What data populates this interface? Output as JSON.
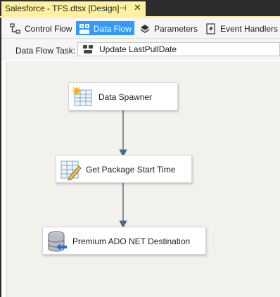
{
  "document_tab": {
    "title": "Salesforce - TFS.dtsx [Design]",
    "pin_glyph": "⊣",
    "close_glyph": "✕"
  },
  "designer_tabs": [
    {
      "label": "Control Flow",
      "icon": "control-flow-icon",
      "active": false
    },
    {
      "label": "Data Flow",
      "icon": "data-flow-icon",
      "active": true
    },
    {
      "label": "Parameters",
      "icon": "parameters-icon",
      "active": false
    },
    {
      "label": "Event Handlers",
      "icon": "event-handlers-icon",
      "active": false
    }
  ],
  "task_selector": {
    "label": "Data Flow Task:",
    "value": "Update LastPullDate",
    "icon": "data-flow-task-icon"
  },
  "canvas": {
    "components": [
      {
        "label": "Data Spawner",
        "icon": "script-component-icon"
      },
      {
        "label": "Get Package Start Time",
        "icon": "derived-column-icon"
      },
      {
        "label": "Premium ADO NET Destination",
        "icon": "ado-net-destination-icon"
      }
    ],
    "connector_color": "#4b6a8b"
  },
  "colors": {
    "tab_accent": "#fff1a0",
    "active_designer_tab": "#3399ff",
    "canvas_background": "#f3f1ec"
  }
}
